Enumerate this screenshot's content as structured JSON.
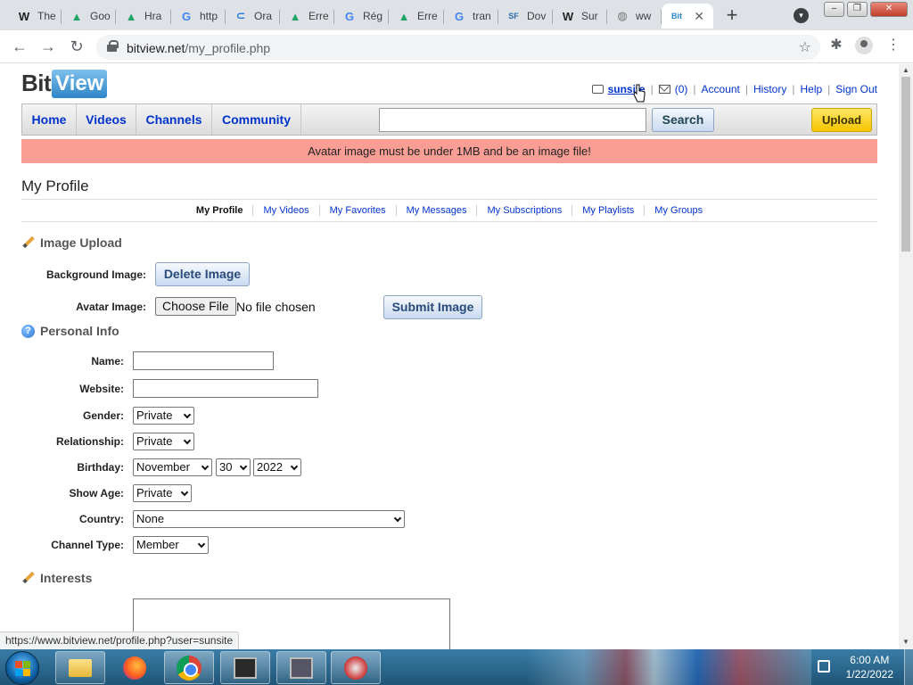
{
  "browser": {
    "tabs": [
      {
        "icon": "wikipedia-icon",
        "glyph": "W",
        "glyph_color": "#222222",
        "label": "The"
      },
      {
        "icon": "google-drive-icon",
        "glyph": "▲",
        "glyph_color": "#1fa463",
        "label": "Goo"
      },
      {
        "icon": "google-drive-icon",
        "glyph": "▲",
        "glyph_color": "#1fa463",
        "label": "Hra"
      },
      {
        "icon": "google-icon",
        "glyph": "G",
        "glyph_color": "#4285f4",
        "label": "http"
      },
      {
        "icon": "oracle-icon",
        "glyph": "⊂",
        "glyph_color": "#2a7bd6",
        "label": "Ora"
      },
      {
        "icon": "google-drive-icon",
        "glyph": "▲",
        "glyph_color": "#1fa463",
        "label": "Erre"
      },
      {
        "icon": "google-icon",
        "glyph": "G",
        "glyph_color": "#4285f4",
        "label": "Rég"
      },
      {
        "icon": "google-drive-icon",
        "glyph": "▲",
        "glyph_color": "#1fa463",
        "label": "Erre"
      },
      {
        "icon": "google-icon",
        "glyph": "G",
        "glyph_color": "#4285f4",
        "label": "tran"
      },
      {
        "icon": "sourceforge-icon",
        "glyph": "SF",
        "glyph_color": "#2a6fb0",
        "label": "Dov"
      },
      {
        "icon": "wikipedia-icon",
        "glyph": "W",
        "glyph_color": "#222222",
        "label": "Sur"
      },
      {
        "icon": "globe-icon",
        "glyph": "◍",
        "glyph_color": "#777777",
        "label": "ww"
      },
      {
        "icon": "bitview-icon",
        "glyph": "Bit",
        "glyph_color": "#2d86c7",
        "label": "",
        "active": true
      }
    ],
    "close_tab_glyph": "✕",
    "new_tab_glyph": "+",
    "url_domain": "bitview.net",
    "url_path": "/my_profile.php"
  },
  "site": {
    "logo_bit": "Bit",
    "logo_view": "View",
    "userbar": {
      "username": "sunsite",
      "messages_count": "(0)",
      "links": [
        "Account",
        "History",
        "Help",
        "Sign Out"
      ]
    },
    "nav": [
      "Home",
      "Videos",
      "Channels",
      "Community"
    ],
    "search_label": "Search",
    "upload_label": "Upload",
    "alert": "Avatar image must be under 1MB and be an image file!",
    "page_title": "My Profile",
    "subnav": [
      "My Profile",
      "My Videos",
      "My Favorites",
      "My Messages",
      "My Subscriptions",
      "My Playlists",
      "My Groups"
    ],
    "image_upload": {
      "heading": "Image Upload",
      "background_label": "Background Image:",
      "delete_label": "Delete Image",
      "avatar_label": "Avatar Image:",
      "choose_file": "Choose File",
      "no_file": "No file chosen",
      "submit_label": "Submit Image"
    },
    "personal_info": {
      "heading": "Personal Info",
      "name_label": "Name:",
      "website_label": "Website:",
      "gender_label": "Gender:",
      "gender_value": "Private",
      "relationship_label": "Relationship:",
      "relationship_value": "Private",
      "birthday_label": "Birthday:",
      "birthday_month": "November",
      "birthday_day": "30",
      "birthday_year": "2022",
      "show_age_label": "Show Age:",
      "show_age_value": "Private",
      "country_label": "Country:",
      "country_value": "None",
      "channel_type_label": "Channel Type:",
      "channel_type_value": "Member"
    },
    "interests_heading": "Interests"
  },
  "status_url": "https://www.bitview.net/profile.php?user=sunsite",
  "taskbar": {
    "time": "6:00 AM",
    "date": "1/22/2022"
  },
  "colors": {
    "link": "#0033cc",
    "alert_bg": "#f99d95",
    "upload_bg": "#f5c400"
  }
}
